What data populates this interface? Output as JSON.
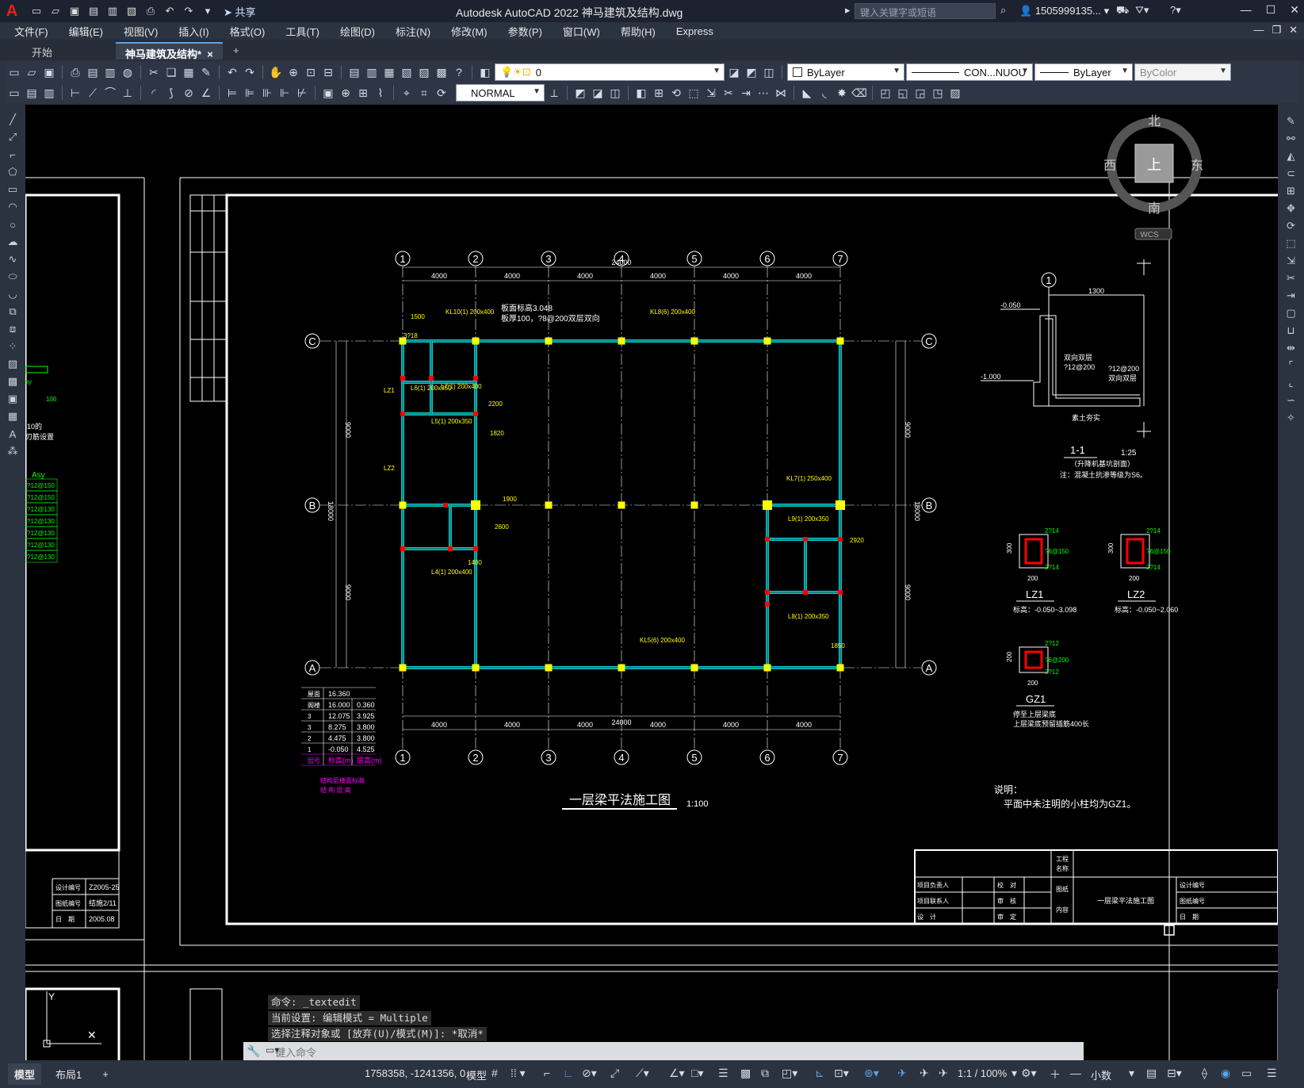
{
  "window": {
    "title": "Autodesk AutoCAD 2022    神马建筑及结构.dwg",
    "share_label": "共享",
    "search_placeholder": "键入关键字或短语",
    "user": "1505999135...",
    "logo": "A"
  },
  "menu": [
    "文件(F)",
    "编辑(E)",
    "视图(V)",
    "插入(I)",
    "格式(O)",
    "工具(T)",
    "绘图(D)",
    "标注(N)",
    "修改(M)",
    "参数(P)",
    "窗口(W)",
    "帮助(H)",
    "Express"
  ],
  "tabs": {
    "start": "开始",
    "active": "神马建筑及结构*",
    "close": "×",
    "add": "+"
  },
  "toolbar1": {
    "layer_value": "0",
    "color_value": "ByLayer",
    "linetype_value": "CON...NUOU",
    "lineweight_value": "ByLayer",
    "plotstyle_value": "ByColor"
  },
  "toolbar2": {
    "textstyle_value": "NORMAL"
  },
  "viewcube": {
    "north": "北",
    "south": "南",
    "east": "东",
    "west": "西",
    "face": "上",
    "wcs": "WCS"
  },
  "drawing": {
    "axis_cols": [
      "1",
      "2",
      "3",
      "4",
      "5",
      "6",
      "7"
    ],
    "axis_rows": [
      "C",
      "B",
      "A"
    ],
    "bay": "4000",
    "total_width": "24000",
    "row_span": "9000",
    "total_height": "18000",
    "title": "一层梁平法施工图",
    "scale": "1:100",
    "notes_title": "说明：",
    "notes_body": "平面中未注明的小柱均为GZ1。",
    "slab_note_1": "板面标高3.048",
    "slab_note_2": "板厚100，?8@200双层双向",
    "section_title": "1-1",
    "section_scale": "1:25",
    "section_sub": "（升降机基坑剖面）",
    "section_note": "注：混凝土抗渗等级为S6。",
    "section_labels": {
      "axis": "1",
      "dim_1300": "1300",
      "lvl_1": "-0.050",
      "lvl_2": "-1.000",
      "rebar_1": "双向双层",
      "rebar_2": "?12@200",
      "rebar_3": "?12@200",
      "rebar_4": "双向双层",
      "soil": "素土夯实"
    },
    "columns_detail": [
      {
        "name": "LZ1",
        "elev": "标高：-0.050~3.098",
        "top": "2?14",
        "stir": "?6@150",
        "bot": "2?14",
        "w": "300",
        "h": "200"
      },
      {
        "name": "LZ2",
        "elev": "标高：-0.050~2.060",
        "top": "2?14",
        "stir": "?6@150",
        "bot": "2?14",
        "w": "300",
        "h": "200"
      },
      {
        "name": "GZ1",
        "elev": "停至上层梁底",
        "note2": "上层梁底预留插筋400长",
        "top": "2?12",
        "stir": "?6@200",
        "bot": "2?12",
        "w": "200",
        "h": "200"
      }
    ],
    "level_table": {
      "rows": [
        [
          "屋面",
          "16.360",
          ""
        ],
        [
          "阁楼",
          "16.000",
          "0.360"
        ],
        [
          "3",
          "12.075",
          "3.925"
        ],
        [
          "3",
          "8.275",
          "3.800"
        ],
        [
          "2",
          "4.475",
          "3.800"
        ],
        [
          "1",
          "-0.050",
          "4.525"
        ],
        [
          "层号",
          "标高(m)",
          "层高(m)"
        ]
      ],
      "caption_1": "结构层楼面标高",
      "caption_2": "结 构 层 高"
    },
    "beams": [
      "KL10(1) 200x400",
      "KL8(6) 200x400",
      "KL7(1) 250x400",
      "KL5(6) 200x400",
      "L6(1) 200x350",
      "L7(1) 200x400",
      "L5(1) 200x350",
      "L4(1) 200x400",
      "L9(1) 200x350",
      "L8(1) 200x350",
      "LZ1",
      "LZ2",
      "3?18",
      "2200",
      "1820",
      "1900",
      "2600",
      "1400",
      "2920",
      "1850",
      "1500"
    ],
    "titleblock_left": [
      [
        "设计编号",
        "Z2005-25"
      ],
      [
        "图纸编号",
        "结施2/11"
      ],
      [
        "日　期",
        "2005.08"
      ]
    ],
    "titleblock_right": {
      "project": "工程名称",
      "drawing": "图纸内容",
      "drawing_name": "一层梁平法施工图",
      "roles": [
        "项目负责人",
        "项目联系人",
        "设　计"
      ],
      "checks": [
        "校　对",
        "审　核",
        "审　定"
      ],
      "right": [
        "设计编号",
        "图纸编号",
        "日　期"
      ]
    },
    "left_partial": {
      "label_asy": "Asy",
      "values": [
        "?12@150",
        "?12@150",
        "?12@130",
        "?12@130",
        "?12@130",
        "?12@130",
        "?12@130"
      ],
      "note1": "10的",
      "note2": "刃筋设置",
      "val100": "100",
      "sy": "sy"
    }
  },
  "command": {
    "history": [
      "命令: _textedit",
      "当前设置: 编辑模式 = Multiple",
      "选择注释对象或 [放弃(U)/模式(M)]: *取消*"
    ],
    "placeholder": "键入命令"
  },
  "statusbar": {
    "model_tab": "模型",
    "layout_tab": "布局1",
    "add": "+",
    "coords": "1758358, -1241356, 0",
    "space": "模型",
    "scale": "1:1 / 100%",
    "units": "小数"
  },
  "colors": {
    "canvas": "#000000",
    "axis_line": "#ffffff",
    "beam": "#00c8c8",
    "column": "#ffff00",
    "annotation": "#ffff00",
    "rebar_green": "#00ff00",
    "magenta": "#ff00ff",
    "red": "#ff0000"
  }
}
